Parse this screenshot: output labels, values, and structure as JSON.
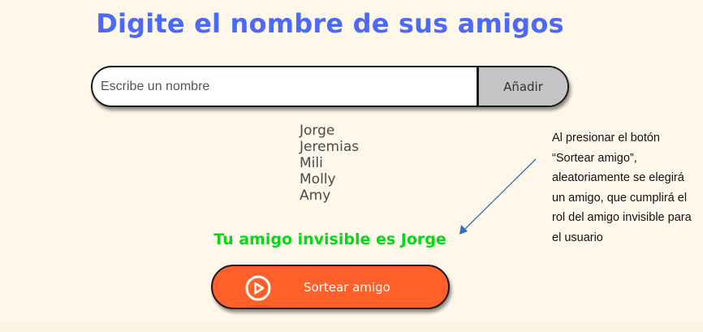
{
  "title": "Digite el nombre de sus amigos",
  "input": {
    "placeholder": "Escribe un nombre",
    "value": ""
  },
  "add_button_label": "Añadir",
  "friends": [
    "Jorge",
    "Jeremias",
    "Mili",
    "Molly",
    "Amy"
  ],
  "result_text": "Tu amigo invisible es Jorge",
  "draw_button": {
    "label": "Sortear amigo",
    "icon": "play-circle-icon"
  },
  "annotation": "Al presionar el botón “Sortear amigo”, aleatoriamente se elegirá un amigo, que cumplirá el rol del amigo invisible para el usuario",
  "colors": {
    "background": "#fff8ea",
    "title": "#4b69fd",
    "result": "#05d917",
    "draw_button": "#ff5f28",
    "add_button": "#c4c4c4",
    "arrow": "#2a6fc7"
  }
}
